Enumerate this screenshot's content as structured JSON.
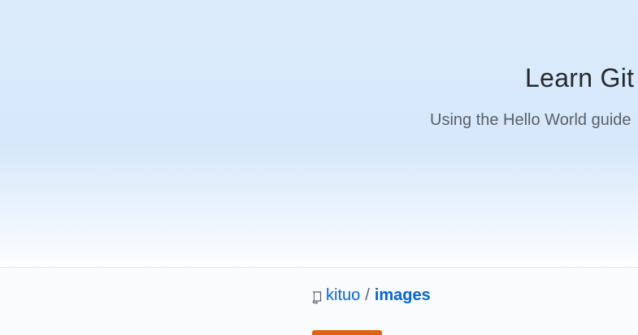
{
  "hero": {
    "title": "Learn Git",
    "subtitle": "Using the Hello World guide"
  },
  "repo": {
    "owner": "kituo",
    "separator": "/",
    "name": "images",
    "icon": "repo-icon"
  },
  "colors": {
    "link": "#0366d6",
    "accent": "#e36209"
  }
}
